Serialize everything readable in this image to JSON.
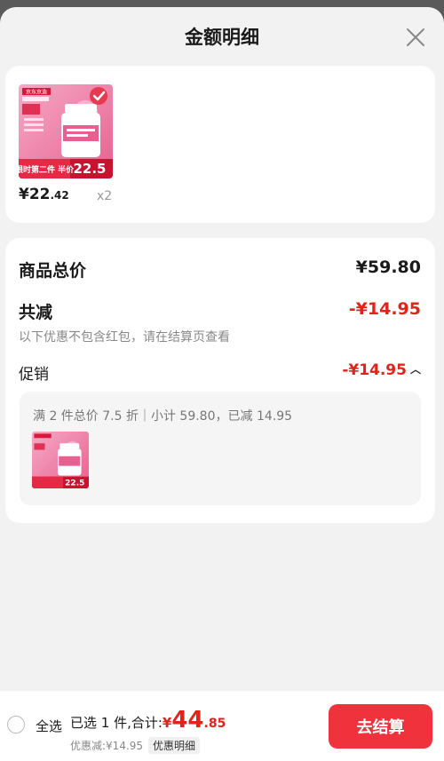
{
  "header": {
    "title": "金额明细"
  },
  "product": {
    "store_badge": "京东京造",
    "promo_tag": "限时第二件 半价",
    "promo_price": "22.5",
    "price_int": "¥22",
    "price_dec": ".42",
    "quantity": "x2"
  },
  "breakdown": {
    "total_label": "商品总价",
    "total_value": "¥59.80",
    "reduce_label": "共减",
    "reduce_value": "-¥14.95",
    "note": "以下优惠不包含红包，请在结算页查看",
    "promo_label": "促销",
    "promo_value": "-¥14.95",
    "promo_desc": "满 2 件总价 7.5 折｜小计 59.80，已减 14.95"
  },
  "footer": {
    "select_all": "全选",
    "selected_text": "已选 1 件,合计:",
    "total_symbol": "¥",
    "total_int": "44",
    "total_dec": ".85",
    "discount_text": "优惠减:¥14.95",
    "detail_label": "优惠明细",
    "checkout_label": "去结算"
  },
  "colors": {
    "accent": "#e2231a",
    "checkout_bg": "#f0323d"
  }
}
